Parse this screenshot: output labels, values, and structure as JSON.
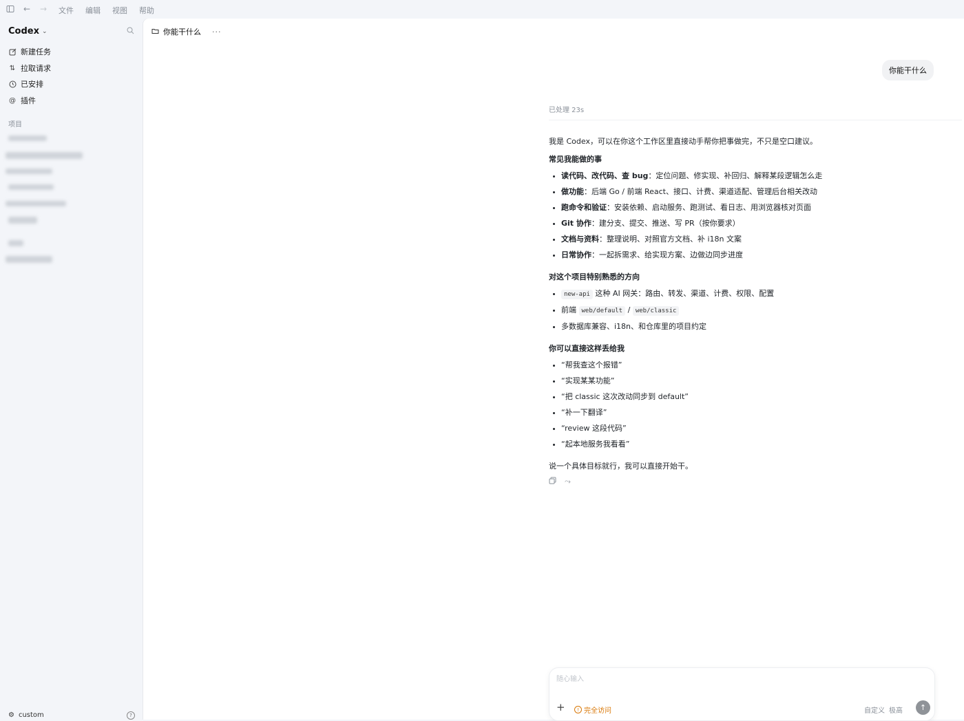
{
  "menubar": {
    "icons": [
      "sidebar-toggle-icon",
      "back-arrow-icon",
      "forward-arrow-icon"
    ],
    "menus": [
      "文件",
      "编辑",
      "视图",
      "帮助"
    ]
  },
  "sidebar": {
    "brand": "Codex",
    "nav": [
      {
        "label": "新建任务",
        "icon": "edit-icon"
      },
      {
        "label": "拉取请求",
        "icon": "pull-request-icon"
      },
      {
        "label": "已安排",
        "icon": "clock-icon"
      },
      {
        "label": "插件",
        "icon": "at-plugin-icon"
      }
    ],
    "section_label": "项目",
    "footer_label": "custom"
  },
  "thread": {
    "title": "你能干什么",
    "user_message": "你能干什么",
    "processed": "已处理 23s",
    "intro": "我是 Codex，可以在你这个工作区里直接动手帮你把事做完，不只是空口建议。",
    "sections": [
      {
        "heading": "常见我能做的事",
        "items": [
          {
            "bold": "读代码、改代码、查 bug",
            "text": "：定位问题、修实现、补回归、解释某段逻辑怎么走"
          },
          {
            "bold": "做功能",
            "text": "：后端 Go / 前端 React、接口、计费、渠道适配、管理后台相关改动"
          },
          {
            "bold": "跑命令和验证",
            "text": "：安装依赖、启动服务、跑测试、看日志、用浏览器核对页面"
          },
          {
            "bold": "Git 协作",
            "text": "：建分支、提交、推送、写 PR（按你要求）"
          },
          {
            "bold": "文档与资料",
            "text": "：整理说明、对照官方文档、补 i18n 文案"
          },
          {
            "bold": "日常协作",
            "text": "：一起拆需求、给实现方案、边做边同步进度"
          }
        ]
      },
      {
        "heading": "对这个项目特别熟悉的方向",
        "items": [
          {
            "code1": "new-api",
            "text": " 这种 AI 网关：路由、转发、渠道、计费、权限、配置"
          },
          {
            "prefix": "前端 ",
            "code1": "web/default",
            "sep": " / ",
            "code2": "web/classic"
          },
          {
            "text": "多数据库兼容、i18n、和仓库里的项目约定"
          }
        ]
      },
      {
        "heading": "你可以直接这样丢给我",
        "items": [
          {
            "text": "“帮我查这个报错”"
          },
          {
            "text": "“实现某某功能”"
          },
          {
            "text": "“把 classic 这次改动同步到 default”"
          },
          {
            "text": "“补一下翻译”"
          },
          {
            "text": "“review 这段代码”"
          },
          {
            "text": "“起本地服务我看看”"
          }
        ]
      }
    ],
    "closing": "说一个具体目标就行，我可以直接开始干。"
  },
  "composer": {
    "placeholder": "随心输入",
    "access_label": "完全访问",
    "config_label": "自定义",
    "speed_label": "极高"
  }
}
